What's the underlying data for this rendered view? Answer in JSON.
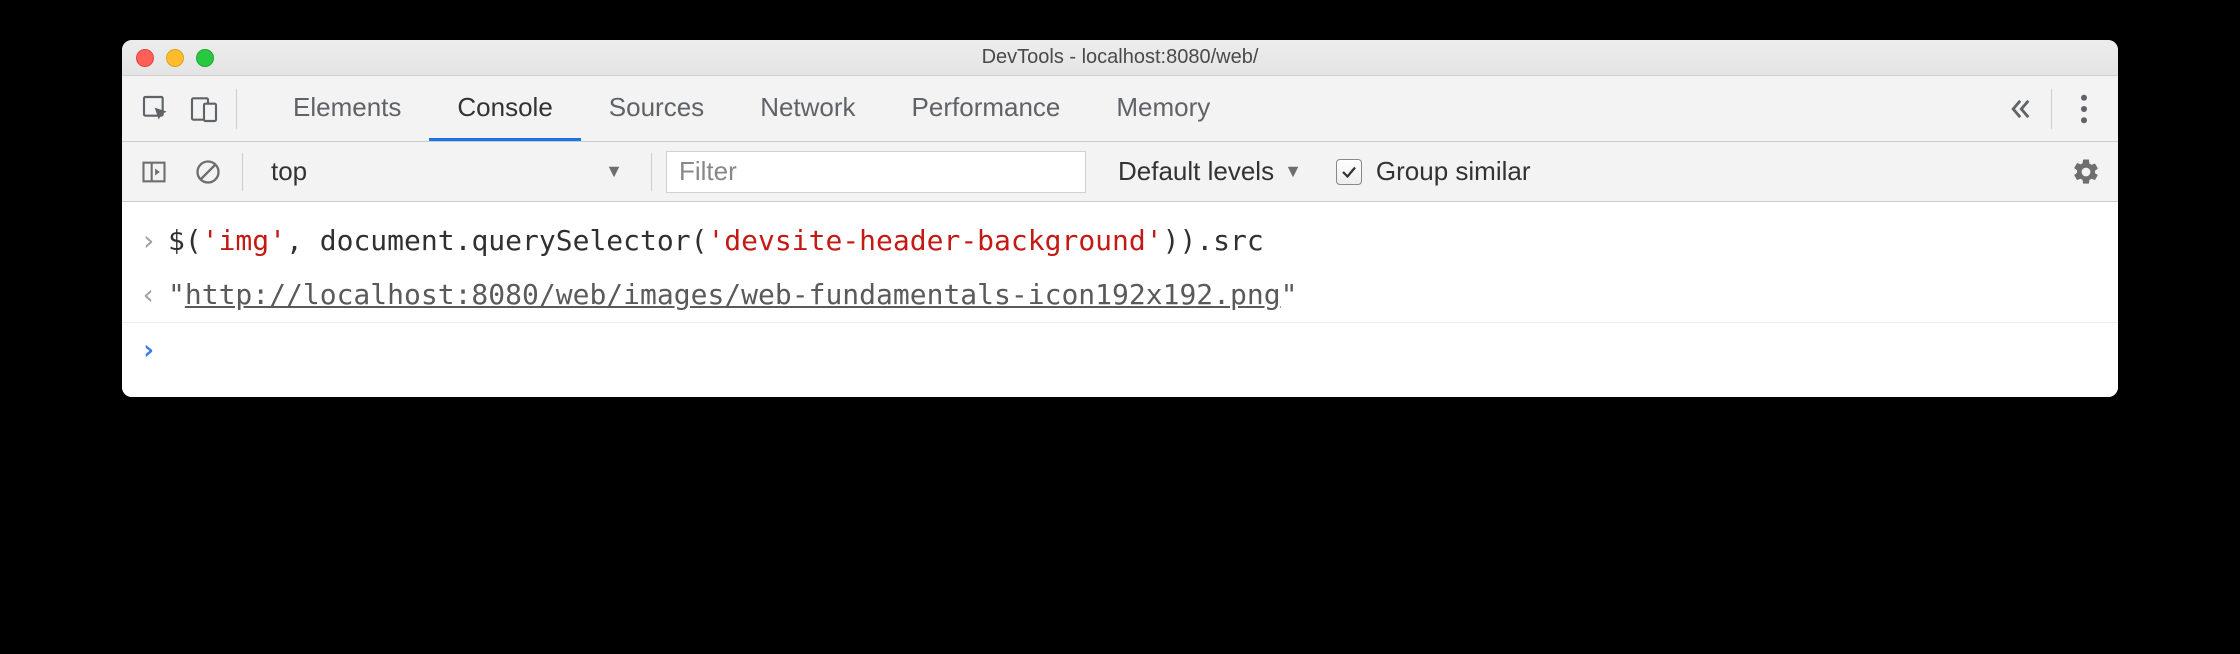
{
  "window": {
    "title": "DevTools - localhost:8080/web/"
  },
  "tabs": {
    "items": [
      "Elements",
      "Console",
      "Sources",
      "Network",
      "Performance",
      "Memory"
    ],
    "active_index": 1
  },
  "toolbar": {
    "context": "top",
    "filter_placeholder": "Filter",
    "levels_label": "Default levels",
    "group_similar_checked": true,
    "group_similar_label": "Group similar"
  },
  "console": {
    "input": {
      "p1": "$(",
      "s1": "'img'",
      "p2": ", document.querySelector(",
      "s2": "'devsite-header-background'",
      "p3": ")).src"
    },
    "output": {
      "q1": "\"",
      "url": "http://localhost:8080/web/images/web-fundamentals-icon192x192.png",
      "q2": "\""
    }
  }
}
